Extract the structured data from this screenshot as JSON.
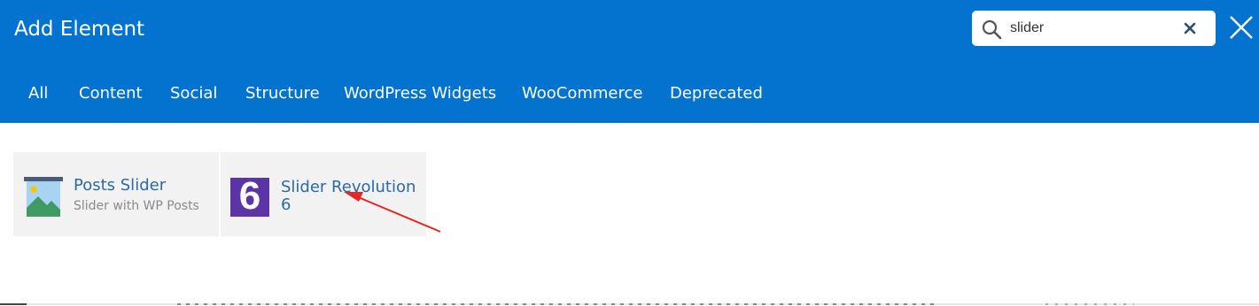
{
  "header": {
    "title": "Add Element",
    "background_color": "#0473cf"
  },
  "search": {
    "value": "slider",
    "icon": "search-icon",
    "clear_icon": "close-icon"
  },
  "close_icon": "close-icon",
  "tabs": [
    {
      "label": "All"
    },
    {
      "label": "Content"
    },
    {
      "label": "Social"
    },
    {
      "label": "Structure"
    },
    {
      "label": "WordPress Widgets"
    },
    {
      "label": "WooCommerce"
    },
    {
      "label": "Deprecated"
    }
  ],
  "results": [
    {
      "title": "Posts Slider",
      "subtitle": "Slider with WP Posts",
      "icon": "image-landscape-icon"
    },
    {
      "title": "Slider Revolution 6",
      "icon": "slider-revolution-icon",
      "icon_glyph": "6",
      "icon_color": "#5b35a6"
    }
  ],
  "annotation": {
    "arrow_color": "#e8261f",
    "icon": "red-arrow-annotation"
  },
  "colors": {
    "link_text": "#2a6aa6",
    "card_bg": "#f2f2f2"
  }
}
